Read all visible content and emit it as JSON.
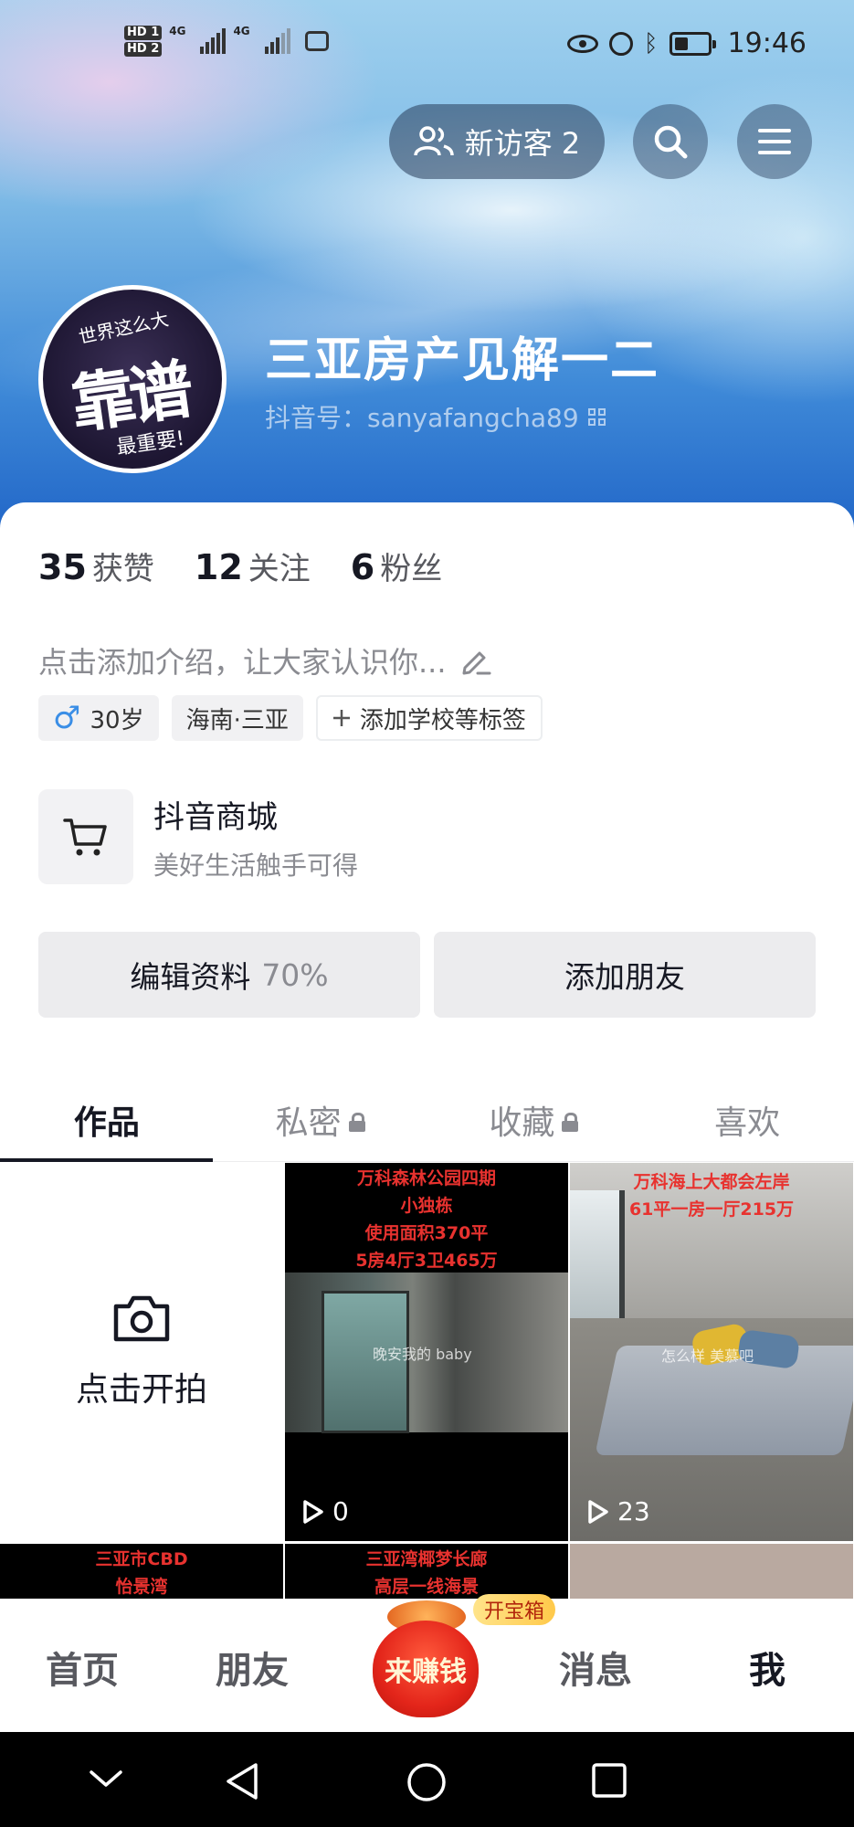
{
  "status_bar": {
    "sim_labels": [
      "HD 1",
      "HD 2"
    ],
    "network_1": "4G",
    "network_2": "4G",
    "time": "19:46"
  },
  "header": {
    "visitor_label": "新访客 2",
    "search_icon": "search-icon",
    "menu_icon": "menu-icon"
  },
  "profile": {
    "avatar_text_top": "世界这么大",
    "avatar_text_main": "靠谱",
    "avatar_text_bottom": "最重要!",
    "name": "三亚房产见解一二",
    "douyin_id": "抖音号：sanyafangcha89"
  },
  "stats": [
    {
      "num": "35",
      "label": "获赞"
    },
    {
      "num": "12",
      "label": "关注"
    },
    {
      "num": "6",
      "label": "粉丝"
    }
  ],
  "bio_placeholder": "点击添加介绍，让大家认识你...",
  "tags": {
    "age": "30岁",
    "gender_symbol": "♂",
    "location": "海南·三亚",
    "add_tag": "添加学校等标签"
  },
  "mall": {
    "title": "抖音商城",
    "subtitle": "美好生活触手可得"
  },
  "actions": {
    "edit_label": "编辑资料",
    "edit_percent": "70%",
    "add_friend_label": "添加朋友"
  },
  "tabs": [
    "作品",
    "私密",
    "收藏",
    "喜欢"
  ],
  "grid": {
    "shoot_label": "点击开拍",
    "videos": [
      {
        "lines": [
          "万科森林公园四期",
          "小独栋",
          "使用面积370平",
          "5房4厅3卫465万"
        ],
        "note": "晚安我的 baby",
        "plays": "0"
      },
      {
        "lines": [
          "万科海上大都会左岸",
          "61平一房一厅215万"
        ],
        "note": "怎么样 美慕吧",
        "plays": "23"
      },
      {
        "lines": [
          "三亚市CBD",
          "怡景湾"
        ]
      },
      {
        "lines": [
          "三亚湾椰梦长廊",
          "高层一线海景"
        ]
      },
      {
        "lines": []
      }
    ]
  },
  "bottom_nav": {
    "home": "首页",
    "friends": "朋友",
    "earn": "来赚钱",
    "treasure": "开宝箱",
    "messages": "消息",
    "me": "我"
  },
  "colors": {
    "accent_blue": "#3a8ee6",
    "text_primary": "#161823",
    "text_secondary": "#8a8b91",
    "earn_red": "#e3251a"
  }
}
